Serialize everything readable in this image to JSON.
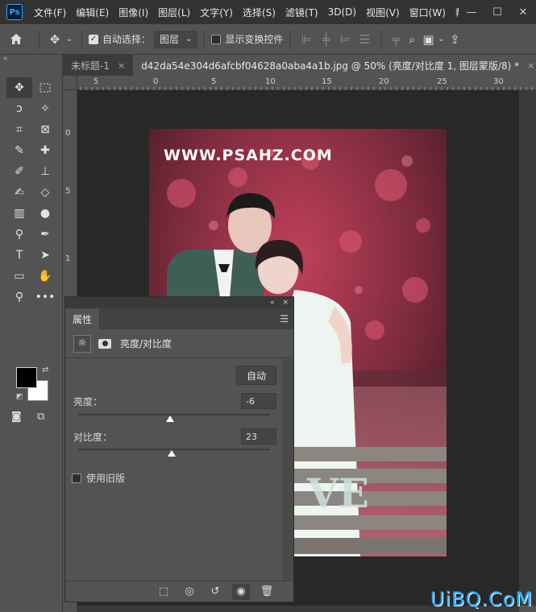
{
  "app": {
    "logo": "Ps",
    "menu": [
      "文件(F)",
      "编辑(E)",
      "图像(I)",
      "图层(L)",
      "文字(Y)",
      "选择(S)",
      "滤镜(T)",
      "3D(D)",
      "视图(V)",
      "窗口(W)",
      "帮助"
    ],
    "window_controls": [
      "—",
      "☐",
      "✕"
    ]
  },
  "options_bar": {
    "auto_select_label": "自动选择：",
    "auto_select_checked": true,
    "layer_select_value": "图层",
    "show_transform_label": "显示变换控件",
    "show_transform_checked": false
  },
  "tabs": [
    {
      "label": "未标题-1",
      "close": "×",
      "active": false
    },
    {
      "label": "d42da54e304d6afcbf04628a0aba4a1b.jpg @ 50% (亮度/对比度 1, 图层蒙版/8) *",
      "close": "×",
      "active": true
    }
  ],
  "ruler": {
    "top_labels": [
      "5",
      "0",
      "5",
      "10",
      "15",
      "20",
      "25",
      "30"
    ],
    "left_labels": [
      "0",
      "5",
      "1"
    ]
  },
  "canvas": {
    "photo_watermark": "WWW.PSAHZ.COM",
    "bench_letters": "VE"
  },
  "tools": {
    "foreground": "#000000",
    "background": "#ffffff"
  },
  "properties": {
    "tab_label": "属性",
    "collapse": "«",
    "close": "×",
    "adjustment_title": "亮度/对比度",
    "auto_button": "自动",
    "brightness_label": "亮度：",
    "brightness_value": "-6",
    "brightness_min": -150,
    "brightness_max": 150,
    "contrast_label": "对比度：",
    "contrast_value": "23",
    "contrast_min": -50,
    "contrast_max": 100,
    "legacy_label": "使用旧版",
    "legacy_checked": false
  },
  "site_watermark": "UiBQ.CoM"
}
